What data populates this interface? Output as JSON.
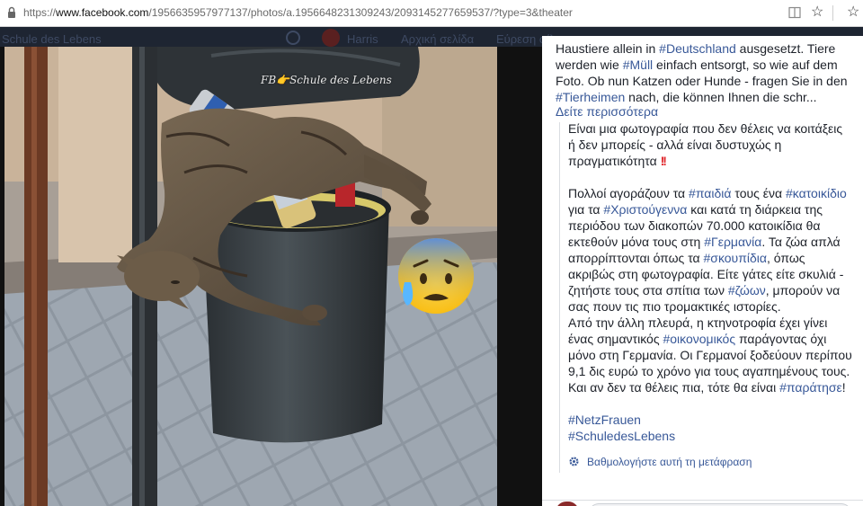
{
  "browser": {
    "url_prefix": "https://",
    "url_domain": "www.facebook.com",
    "url_path": "/1956635957977137/photos/a.1956648231309243/2093145277659537/?type=3&theater",
    "star_glyph": "☆"
  },
  "background_bar": {
    "group_name": "Schule des Lebens",
    "nav_1": "Harris",
    "nav_2": "Αρχική σελίδα",
    "nav_3": "Εύρεση φίλων"
  },
  "photo": {
    "watermark": "FB👉Schule des Lebens",
    "emoji": "😰"
  },
  "post": {
    "original": {
      "line1_a": "Haustiere allein in ",
      "line1_tag": "#Deutschland",
      "line1_b": " ausgesetzt. Tiere",
      "line2_a": "werden wie ",
      "line2_tag": "#Müll",
      "line2_b": " einfach entsorgt, so wie auf dem",
      "line3": "Foto. Ob nun Katzen oder Hunde - fragen Sie in den",
      "line4_tag": "#Tierheimen",
      "line4_b": " nach, die können Ihnen die schr..."
    },
    "see_more": "Δείτε περισσότερα",
    "translation": {
      "p1": "Είναι μια φωτογραφία που δεν θέλεις να κοιτάξεις ή δεν μπορείς - αλλά είναι δυστυχώς η πραγματικότητα ",
      "p1_bang": "!!",
      "p2_a": "Πολλοί αγοράζουν τα ",
      "p2_t1": "#παιδιά",
      "p2_b": " τους ένα ",
      "p2_t2": "#κατοικίδιο",
      "p2_c": " για τα ",
      "p2_t3": "#Χριστούγεννα",
      "p2_d": " και κατά τη διάρκεια της περιόδου των διακοπών 70.000 κατοικίδια θα εκτεθούν μόνα τους στη ",
      "p2_t4": "#Γερμανία",
      "p2_e": ". Τα ζώα απλά απορρίπτονται όπως τα ",
      "p2_t5": "#σκουπίδια",
      "p2_f": ", όπως ακριβώς στη φωτογραφία. Είτε γάτες είτε σκυλιά - ζητήστε τους στα σπίτια των ",
      "p2_t6": "#ζώων",
      "p2_g": ", μπορούν να σας πουν τις πιο τρομακτικές ιστορίες.",
      "p3_a": "Από την άλλη πλευρά, η κτηνοτροφία έχει γίνει ένας σημαντικός ",
      "p3_t1": "#οικονομικός",
      "p3_b": " παράγοντας όχι μόνο στη Γερμανία. Οι Γερμανοί ξοδεύουν περίπου 9,1 δις ευρώ το χρόνο για τους αγαπημένους τους.",
      "p4_a": "Και αν δεν τα θέλεις πια, τότε θα είναι ",
      "p4_t1": "#παράτησε",
      "p4_b": "!",
      "tag_a": "#NetzFrauen",
      "tag_b": "#SchuledesLebens"
    },
    "rate_translation": "Βαθμολογήστε αυτή τη μετάφραση"
  },
  "colors": {
    "link": "#385898",
    "text": "#1d2129",
    "panel_bg": "#ffffff",
    "page_bg": "#1c1c1c"
  }
}
